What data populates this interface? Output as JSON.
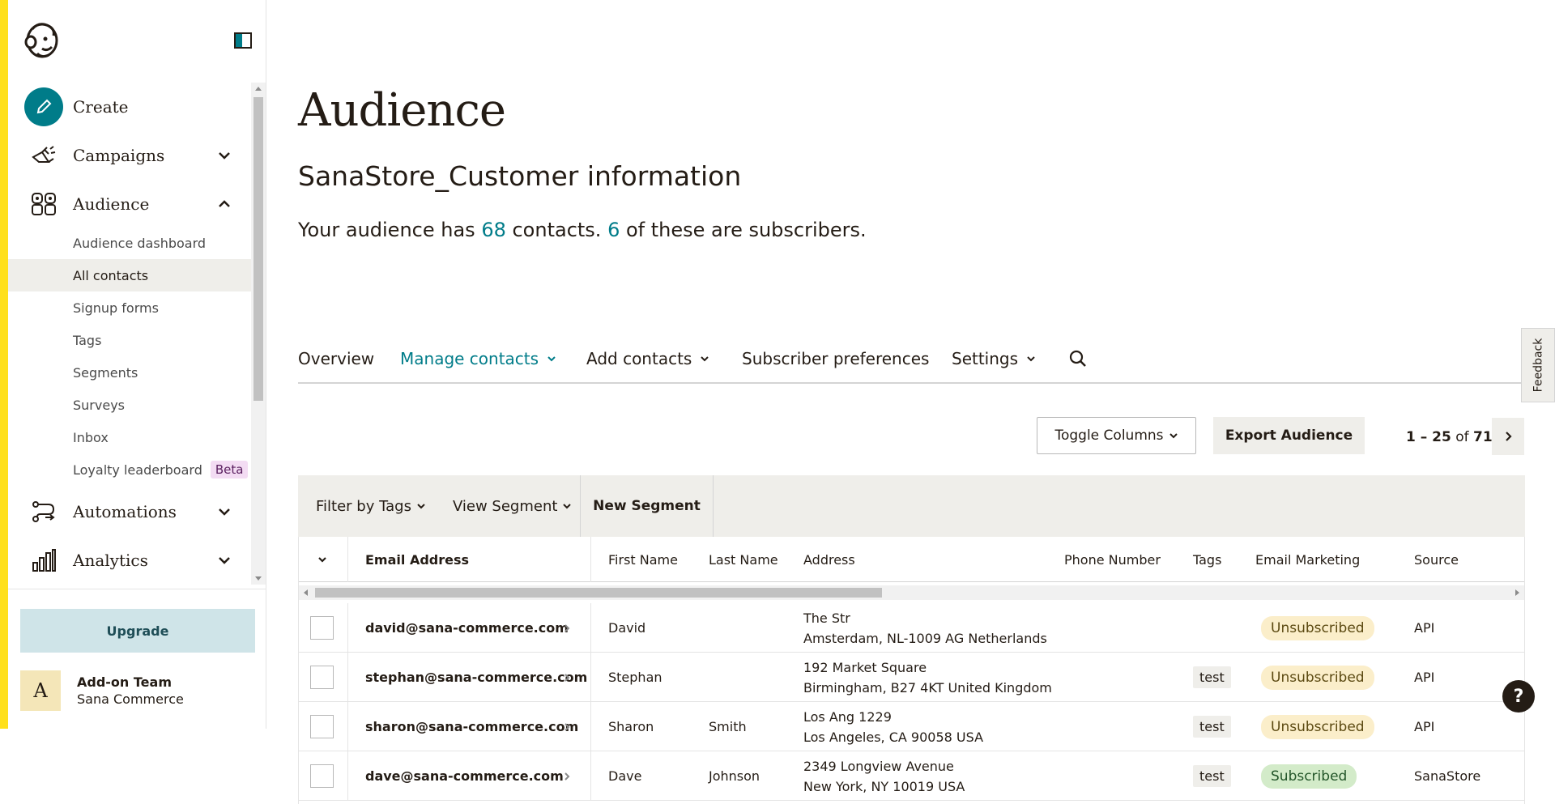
{
  "sidebar": {
    "nav": {
      "create": "Create",
      "campaigns": "Campaigns",
      "audience": "Audience",
      "automations": "Automations",
      "analytics": "Analytics"
    },
    "audience_sub": [
      {
        "label": "Audience dashboard"
      },
      {
        "label": "All contacts"
      },
      {
        "label": "Signup forms"
      },
      {
        "label": "Tags"
      },
      {
        "label": "Segments"
      },
      {
        "label": "Surveys"
      },
      {
        "label": "Inbox"
      },
      {
        "label": "Loyalty leaderboard"
      }
    ],
    "beta_badge": "Beta",
    "upgrade": "Upgrade",
    "account": {
      "avatar_letter": "A",
      "name": "Add-on Team",
      "org": "Sana Commerce"
    }
  },
  "main": {
    "title": "Audience",
    "audience_name": "SanaStore_Customer information",
    "summary": {
      "prefix": "Your audience has ",
      "contacts": "68",
      "middle": " contacts. ",
      "subscribers": "6",
      "suffix": " of these are subscribers."
    },
    "tabs": {
      "overview": "Overview",
      "manage": "Manage contacts",
      "add": "Add contacts",
      "prefs": "Subscriber preferences",
      "settings": "Settings"
    },
    "toolbar": {
      "toggle_columns": "Toggle Columns",
      "export": "Export Audience",
      "pager_range": "1 – 25",
      "pager_of": " of ",
      "pager_total": "71"
    },
    "filters": {
      "tags": "Filter by Tags",
      "segment": "View Segment",
      "new_segment": "New Segment"
    },
    "table": {
      "headers": {
        "email": "Email Address",
        "first": "First Name",
        "last": "Last Name",
        "address": "Address",
        "phone": "Phone Number",
        "tags": "Tags",
        "marketing": "Email Marketing",
        "source": "Source"
      },
      "rows": [
        {
          "email": "david@sana-commerce.com",
          "first": "David",
          "last": "",
          "addr1": "The Str",
          "addr2": "Amsterdam, NL-1009 AG Netherlands",
          "tag": "",
          "status": "Unsubscribed",
          "source": "API"
        },
        {
          "email": "stephan@sana-commerce.com",
          "first": "Stephan",
          "last": "",
          "addr1": "192 Market Square",
          "addr2": "Birmingham, B27 4KT United Kingdom",
          "tag": "test",
          "status": "Unsubscribed",
          "source": "API"
        },
        {
          "email": "sharon@sana-commerce.com",
          "first": "Sharon",
          "last": "Smith",
          "addr1": "Los Ang 1229",
          "addr2": "Los Angeles, CA 90058 USA",
          "tag": "test",
          "status": "Unsubscribed",
          "source": "API"
        },
        {
          "email": "dave@sana-commerce.com",
          "first": "Dave",
          "last": "Johnson",
          "addr1": "2349 Longview Avenue",
          "addr2": "New York, NY 10019 USA",
          "tag": "test",
          "status": "Subscribed",
          "source": "SanaStore"
        }
      ]
    }
  },
  "feedback": "Feedback",
  "help": "?",
  "colors": {
    "accent": "#007c89",
    "brand_yellow": "#ffe01b",
    "unsubscribed_bg": "#fbeeca",
    "subscribed_bg": "#d3ebc9"
  }
}
